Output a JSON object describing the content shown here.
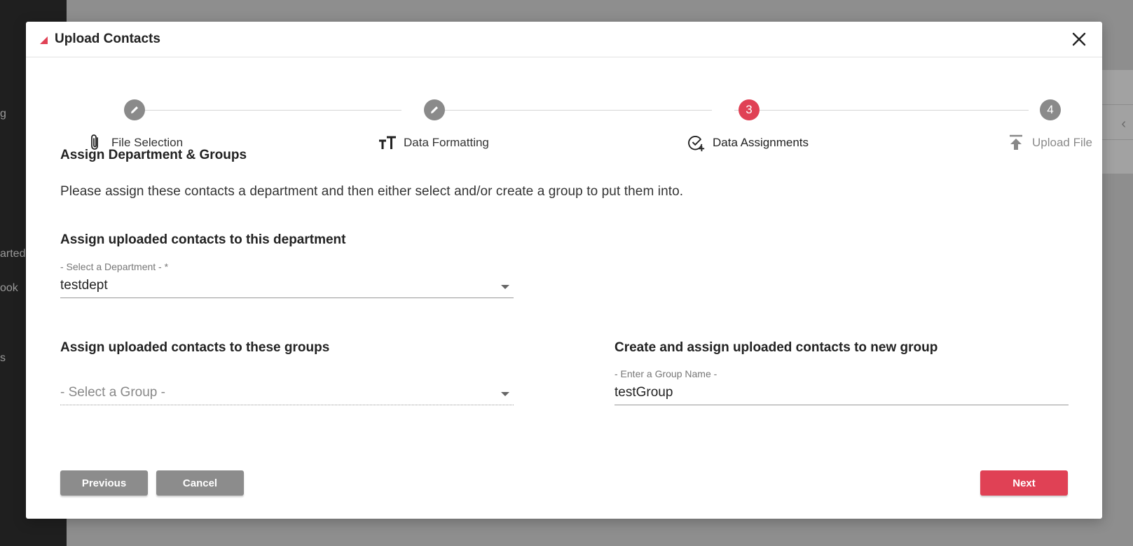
{
  "background": {
    "sidebar_fragments": [
      "g",
      "arted",
      "ook",
      "s"
    ]
  },
  "modal": {
    "title": "Upload Contacts",
    "close_icon": "close-icon"
  },
  "stepper": {
    "steps": [
      {
        "marker": "",
        "marker_icon": "pencil-icon",
        "label": "File Selection",
        "icon": "paperclip-icon",
        "state": "done"
      },
      {
        "marker": "",
        "marker_icon": "pencil-icon",
        "label": "Data Formatting",
        "icon": "text-size-icon",
        "state": "done"
      },
      {
        "marker": "3",
        "label": "Data Assignments",
        "icon": "check-circle-plus-icon",
        "state": "active"
      },
      {
        "marker": "4",
        "label": "Upload File",
        "icon": "upload-icon",
        "state": "pending"
      }
    ]
  },
  "assign": {
    "heading": "Assign Department & Groups",
    "description": "Please assign these contacts a department and then either select and/or create a group to put them into.",
    "department_heading": "Assign uploaded contacts to this department",
    "department_label": "- Select a Department - *",
    "department_value": "testdept",
    "groups_heading": "Assign uploaded contacts to these groups",
    "groups_placeholder": "- Select a Group -",
    "new_group_heading": "Create and assign uploaded contacts to new group",
    "new_group_label": "- Enter a Group Name -",
    "new_group_value": "testGroup"
  },
  "buttons": {
    "previous": "Previous",
    "cancel": "Cancel",
    "next": "Next"
  },
  "colors": {
    "accent": "#e04155",
    "neutral": "#8c8c8c"
  }
}
